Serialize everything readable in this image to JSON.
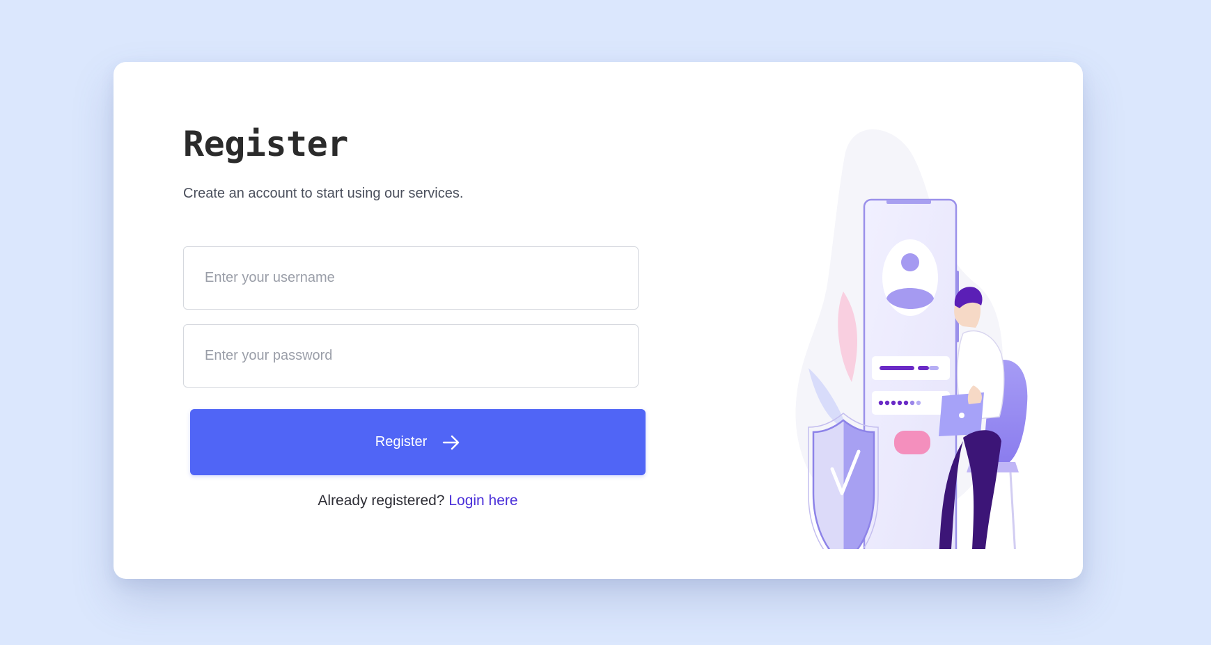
{
  "form": {
    "title": "Register",
    "subtitle": "Create an account to start using our services.",
    "username": {
      "placeholder": "Enter your username",
      "value": ""
    },
    "password": {
      "placeholder": "Enter your password",
      "value": ""
    },
    "submit_label": "Register",
    "submit_icon": "arrow-right-icon",
    "login_prompt": "Already registered?",
    "login_link": "Login here"
  },
  "colors": {
    "background": "#dbe7fd",
    "card": "#ffffff",
    "accent": "#5065f6",
    "link": "#4a2fd9",
    "illustration_purple": "#8d7cf0"
  },
  "illustration": {
    "name": "security-registration-illustration",
    "password_dots": 7
  }
}
